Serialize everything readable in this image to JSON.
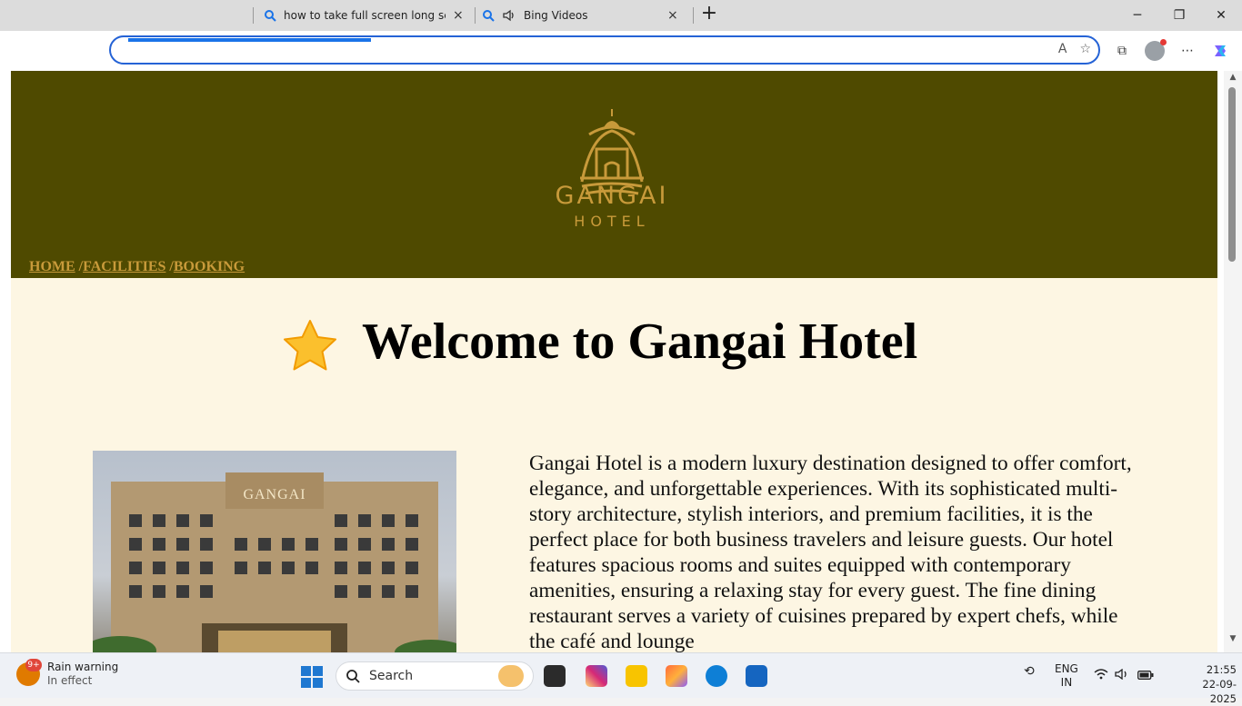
{
  "browser": {
    "tabs": [
      {
        "title": "how to take full screen long scree",
        "close": "×"
      },
      {
        "title": "Bing Videos",
        "close": "×"
      }
    ],
    "new_tab": "+",
    "window_controls": {
      "minimize": "─",
      "maximize": "❐",
      "close": "✕"
    }
  },
  "site": {
    "logo_word": "GANGAI",
    "logo_sub": "HOTEL",
    "nav": {
      "home": "HOME",
      "facilities": "FACILITIES",
      "booking": "BOOKING",
      "separator": " /"
    },
    "hero_title": "Welcome to Gangai Hotel",
    "hotel_sign": "GANGAI",
    "about": "Gangai Hotel is a modern luxury destination designed to offer comfort, elegance, and unforgettable experiences. With its sophisticated multi-story architecture, stylish interiors, and premium facilities, it is the perfect place for both business travelers and leisure guests. Our hotel features spacious rooms and suites equipped with contemporary amenities, ensuring a relaxing stay for every guest. The fine dining restaurant serves a variety of cuisines prepared by expert chefs, while the café and lounge"
  },
  "taskbar": {
    "weather_badge": "9+",
    "weather_title": "Rain warning",
    "weather_sub": "In effect",
    "search_label": "Search",
    "lang_1": "ENG",
    "lang_2": "IN",
    "time": "21:55",
    "date": "22-09-2025"
  },
  "colors": {
    "header_bg": "#4f4a00",
    "page_bg": "#fdf6e3",
    "gold": "#c89a3a",
    "accent_blue": "#1a73e8"
  }
}
